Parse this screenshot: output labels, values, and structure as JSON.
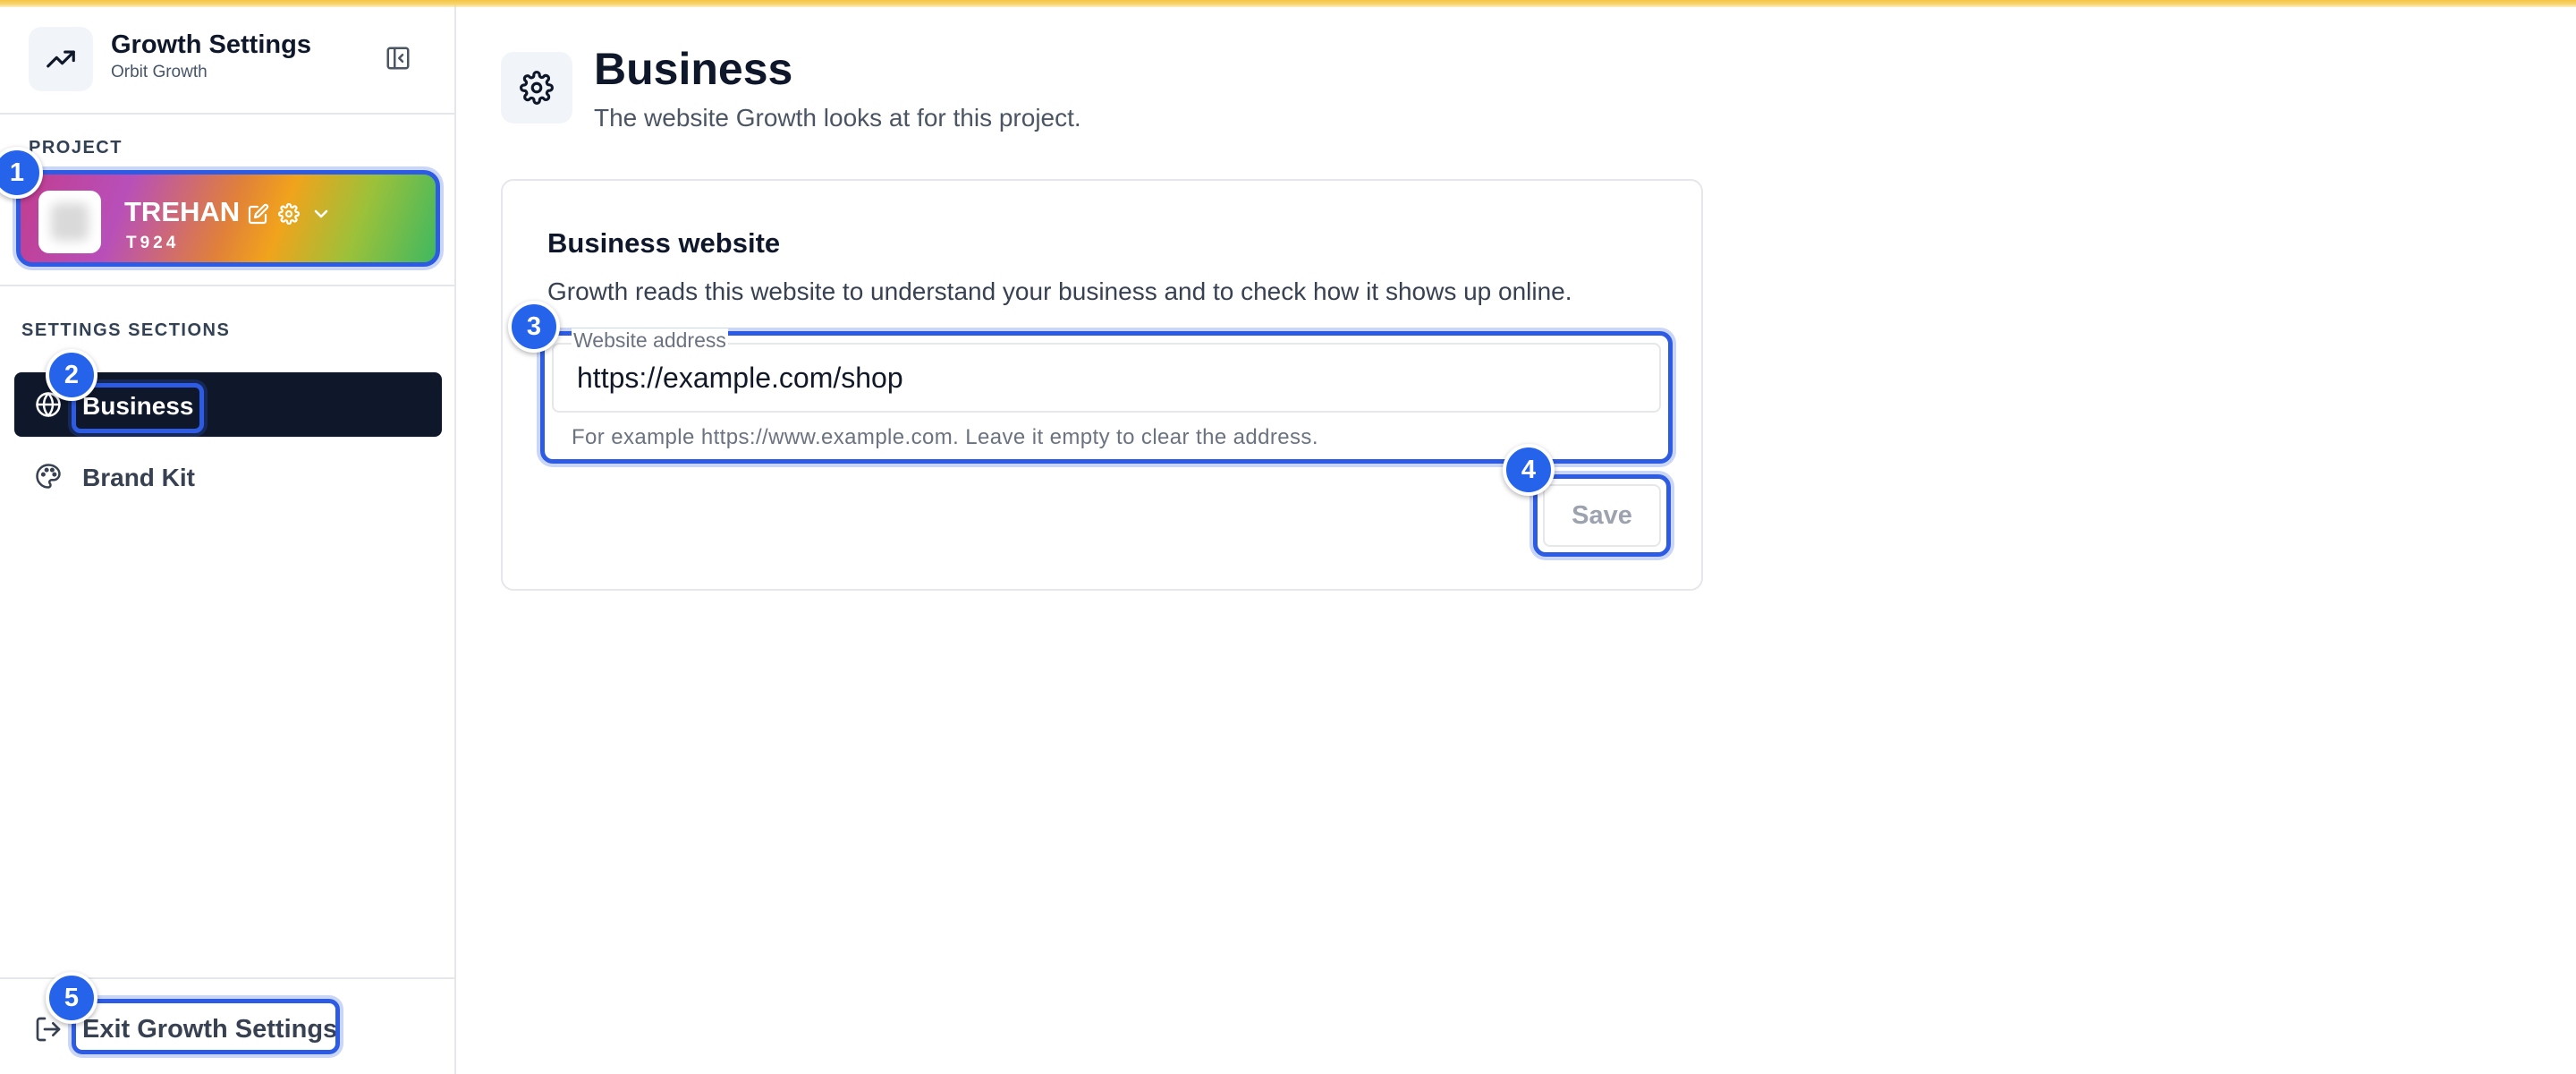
{
  "app": {
    "title": "Growth Settings",
    "subtitle": "Orbit Growth",
    "icon": "trending-up-icon",
    "collapse_icon": "panel-left-close-icon"
  },
  "sidebar": {
    "project_section_label": "PROJECT",
    "project": {
      "name": "TREHAN",
      "code": "T924",
      "actions": [
        "edit-icon",
        "gear-icon",
        "chevron-down-icon"
      ]
    },
    "settings_section_label": "SETTINGS SECTIONS",
    "items": [
      {
        "label": "Business",
        "icon": "globe-icon",
        "active": true
      },
      {
        "label": "Brand Kit",
        "icon": "palette-icon",
        "active": false
      }
    ],
    "exit_label": "Exit Growth Settings",
    "exit_icon": "log-out-icon"
  },
  "main": {
    "title": "Business",
    "subtitle": "The website Growth looks at for this project.",
    "icon": "gear-icon",
    "card": {
      "title": "Business website",
      "description": "Growth reads this website to understand your business and to check how it shows up online.",
      "field_label": "Website address",
      "field_value": "https://example.com/shop",
      "field_help": "For example https://www.example.com. Leave it empty to clear the address.",
      "save_label": "Save"
    }
  },
  "annotations": [
    "1",
    "2",
    "3",
    "4",
    "5"
  ],
  "colors": {
    "accent": "#2d5be3",
    "badge": "#2563eb",
    "active_nav": "#0f172a",
    "top_bar": "#f5c542"
  }
}
